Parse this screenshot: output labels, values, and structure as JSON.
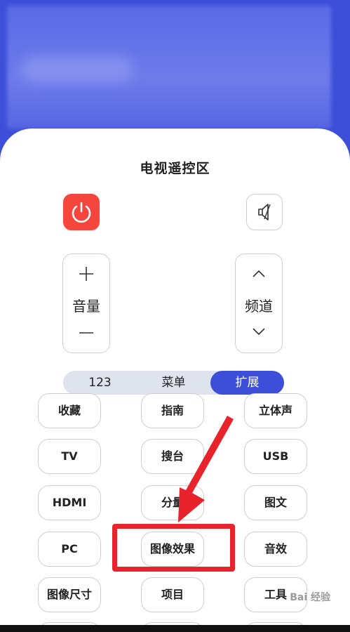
{
  "title": "电视遥控区",
  "controls": {
    "volume_label": "音量",
    "channel_label": "频道",
    "plus": "+",
    "minus": "—"
  },
  "tabs": [
    {
      "label": "123",
      "active": false
    },
    {
      "label": "菜单",
      "active": false
    },
    {
      "label": "扩展",
      "active": true
    }
  ],
  "keys": [
    [
      "收藏",
      "指南",
      "立体声"
    ],
    [
      "TV",
      "搜台",
      "USB"
    ],
    [
      "HDMI",
      "分量",
      "图文"
    ],
    [
      "PC",
      "图像效果",
      "音效"
    ],
    [
      "图像尺寸",
      "项目",
      "工具"
    ]
  ],
  "watermark": "Bai 经验",
  "colors": {
    "accent": "#3d4fd8",
    "power": "#f5463d",
    "annotation_red": "#e8232b"
  }
}
